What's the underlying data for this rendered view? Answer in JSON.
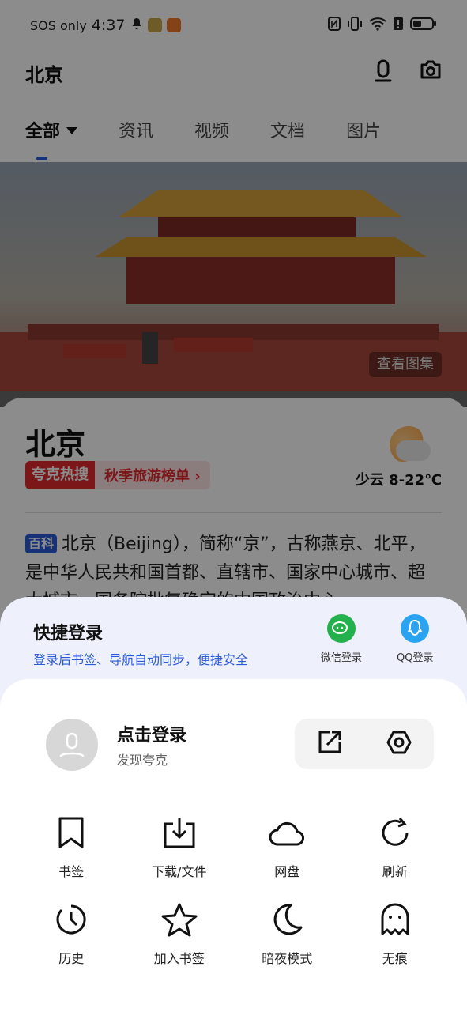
{
  "status_bar": {
    "carrier": "SOS only",
    "time": "4:37"
  },
  "search": {
    "query": "北京"
  },
  "tabs": [
    {
      "label": "全部"
    },
    {
      "label": "资讯"
    },
    {
      "label": "视频"
    },
    {
      "label": "文档"
    },
    {
      "label": "图片"
    }
  ],
  "hero": {
    "gallery_button": "查看图集"
  },
  "card": {
    "title": "北京",
    "hot_brand": "夸克热搜",
    "hot_text": "秋季旅游榜单 ›",
    "weather": "少云 8-22℃",
    "baike_tag": "百科",
    "summary": "北京（Beijing），简称“京”，古称燕京、北平，是中华人民共和国首都、直辖市、国家中心城市、超大城市，国务院批复确定的中国政治中心"
  },
  "sheet": {
    "login_title": "快捷登录",
    "login_sub": "登录后书签、导航自动同步，便捷安全",
    "wechat_label": "微信登录",
    "qq_label": "QQ登录",
    "user_name": "点击登录",
    "user_sub": "发现夸克",
    "grid": [
      {
        "label": "书签",
        "icon": "bookmark-icon"
      },
      {
        "label": "下载/文件",
        "icon": "download-icon"
      },
      {
        "label": "网盘",
        "icon": "cloud-icon"
      },
      {
        "label": "刷新",
        "icon": "refresh-icon"
      },
      {
        "label": "历史",
        "icon": "history-icon"
      },
      {
        "label": "加入书签",
        "icon": "star-icon"
      },
      {
        "label": "暗夜模式",
        "icon": "moon-icon"
      },
      {
        "label": "无痕",
        "icon": "ghost-icon"
      }
    ]
  },
  "colors": {
    "accent": "#2a5ad9",
    "hot": "#e0282e",
    "wechat": "#22b14c",
    "qq": "#2aa3f0"
  }
}
